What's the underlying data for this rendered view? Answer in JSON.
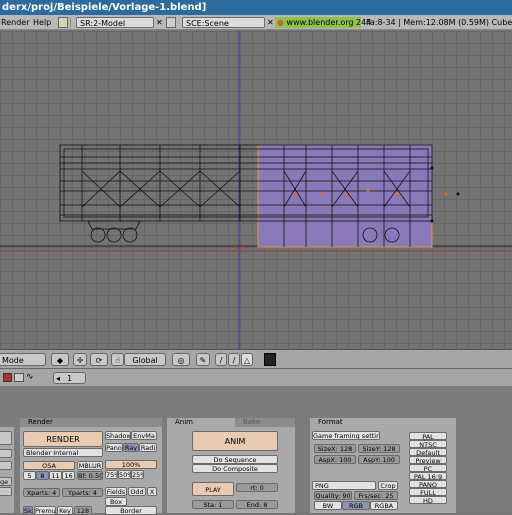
{
  "window": {
    "title": "derx/proj/Beispiele/Vorlage-1.blend]"
  },
  "menu": {
    "render": "Render",
    "help": "Help",
    "screen": "SR:2-Model",
    "scene": "SCE:Scene",
    "url": "www.blender.org 244",
    "stats": "Fa:8-34 | Mem:12.08M (0.59M) Cube.003"
  },
  "view_header": {
    "mode": "Mode",
    "orientation": "Global"
  },
  "buttons_header": {
    "frame": "1"
  },
  "panels": {
    "render": {
      "title": "Render",
      "render_btn": "RENDER",
      "shadow": "Shadow",
      "envmap": "EnvMa",
      "pano": "Pano",
      "ray": "Ray",
      "radio": "Radi",
      "engine": "Blender Internal",
      "osa": "OSA",
      "mblur": "MBLUR",
      "bf": "Bf: 0.50",
      "osa_vals": [
        "5",
        "8",
        "11",
        "16"
      ],
      "xparts": "Xparts: 4",
      "yparts": "Yparts: 4",
      "fields": "Fields",
      "odd": "Odd",
      "x": "X",
      "box": "Box",
      "pct": [
        "100%",
        "75%",
        "50%",
        "25%"
      ],
      "sky": "Sky",
      "premul": "Premul",
      "key": "Key",
      "k128": "128",
      "border": "Border",
      "ge": "ge"
    },
    "anim": {
      "title": "Anim",
      "bake": "Bake",
      "anim_btn": "ANIM",
      "do_sequence": "Do Sequence",
      "do_composite": "Do Composite",
      "play": "PLAY",
      "rt": "rt: 0",
      "sta": "Sta: 1",
      "end": "End: 8"
    },
    "format": {
      "title": "Format",
      "game": "Game framing settings",
      "sizex": "SizeX: 128",
      "sizey": "SizeY: 128",
      "aspx": "AspX: 100",
      "aspy": "AspY: 100",
      "png": "PNG",
      "crop": "Crop",
      "quality": "Quality: 90",
      "frs": "Frs/sec: 25",
      "bw": "BW",
      "rgb": "RGB",
      "rgba": "RGBA",
      "presets": [
        "PAL",
        "NTSC",
        "Default",
        "Preview",
        "PC",
        "PAL 16:9",
        "PANO",
        "FULL",
        "HD"
      ]
    }
  }
}
